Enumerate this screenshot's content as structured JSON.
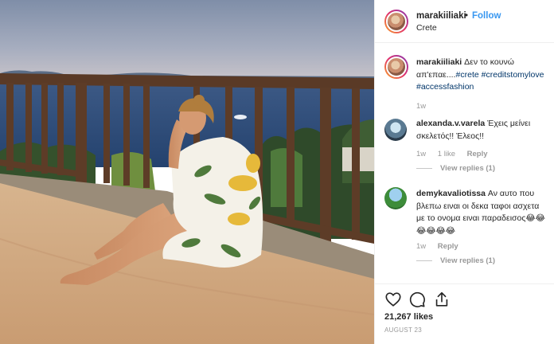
{
  "post": {
    "username": "marakiiliaki",
    "separator": "•",
    "follow_label": "Follow",
    "location": "Crete"
  },
  "caption": {
    "username": "marakiiliaki",
    "text": "Δεν το κουνώ απ'επαε....",
    "tags": [
      "#crete",
      "#creditstomylove",
      "#accessfashion"
    ],
    "time": "1w"
  },
  "comments": [
    {
      "username": "alexanda.v.varela",
      "text": "Έχεις μείνει σκελετός!! Έλεος!!",
      "time": "1w",
      "likes": "1 like",
      "reply_label": "Reply",
      "view_replies": "View replies (1)"
    },
    {
      "username": "demykavaliotissa",
      "text": "Αν αυτο που βλεπω ειναι οι δεκα ταφοι ασχετα με το ονομα ειναι παραδεισος😂😂😂😂😂😂",
      "time": "1w",
      "reply_label": "Reply",
      "view_replies": "View replies (1)"
    }
  ],
  "footer": {
    "likes": "21,267 likes",
    "date": "AUGUST 23"
  },
  "icons": [
    "heart-icon",
    "comment-icon",
    "share-icon"
  ],
  "colors": {
    "accent": "#3897f0",
    "text": "#262626",
    "muted": "#999999",
    "hashtag": "#003569"
  }
}
